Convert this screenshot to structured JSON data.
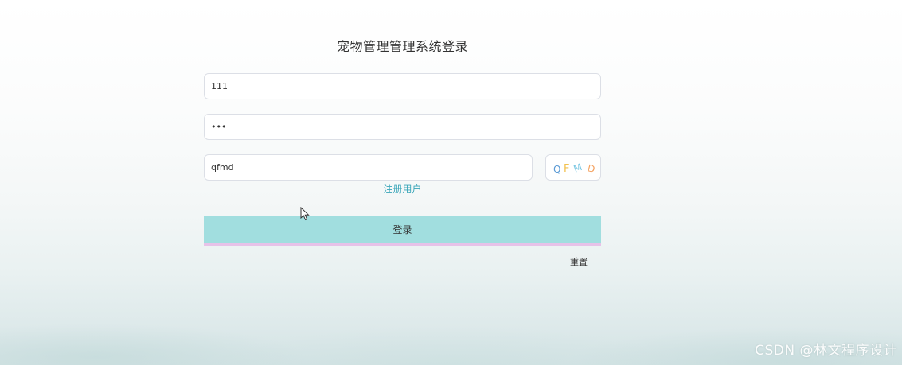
{
  "page": {
    "title": "宠物管理管理系统登录"
  },
  "form": {
    "username_value": "111",
    "password_value": "111",
    "captcha_value": "qfmd",
    "captcha_image_text": "QFMD",
    "register_link": "注册用户",
    "login_button": "登录",
    "reset_button": "重置"
  },
  "watermark": "CSDN @林文程序设计",
  "colors": {
    "login_button_bg": "#a1dedf",
    "login_button_border": "#e7c2e8",
    "register_link": "#3aa6b9",
    "captcha_q": "#5b9bd5",
    "captcha_f": "#f2c14e",
    "captcha_m": "#7ec8e3",
    "captcha_d": "#f4a261"
  },
  "icons": {
    "cursor": "mouse-pointer-icon"
  }
}
